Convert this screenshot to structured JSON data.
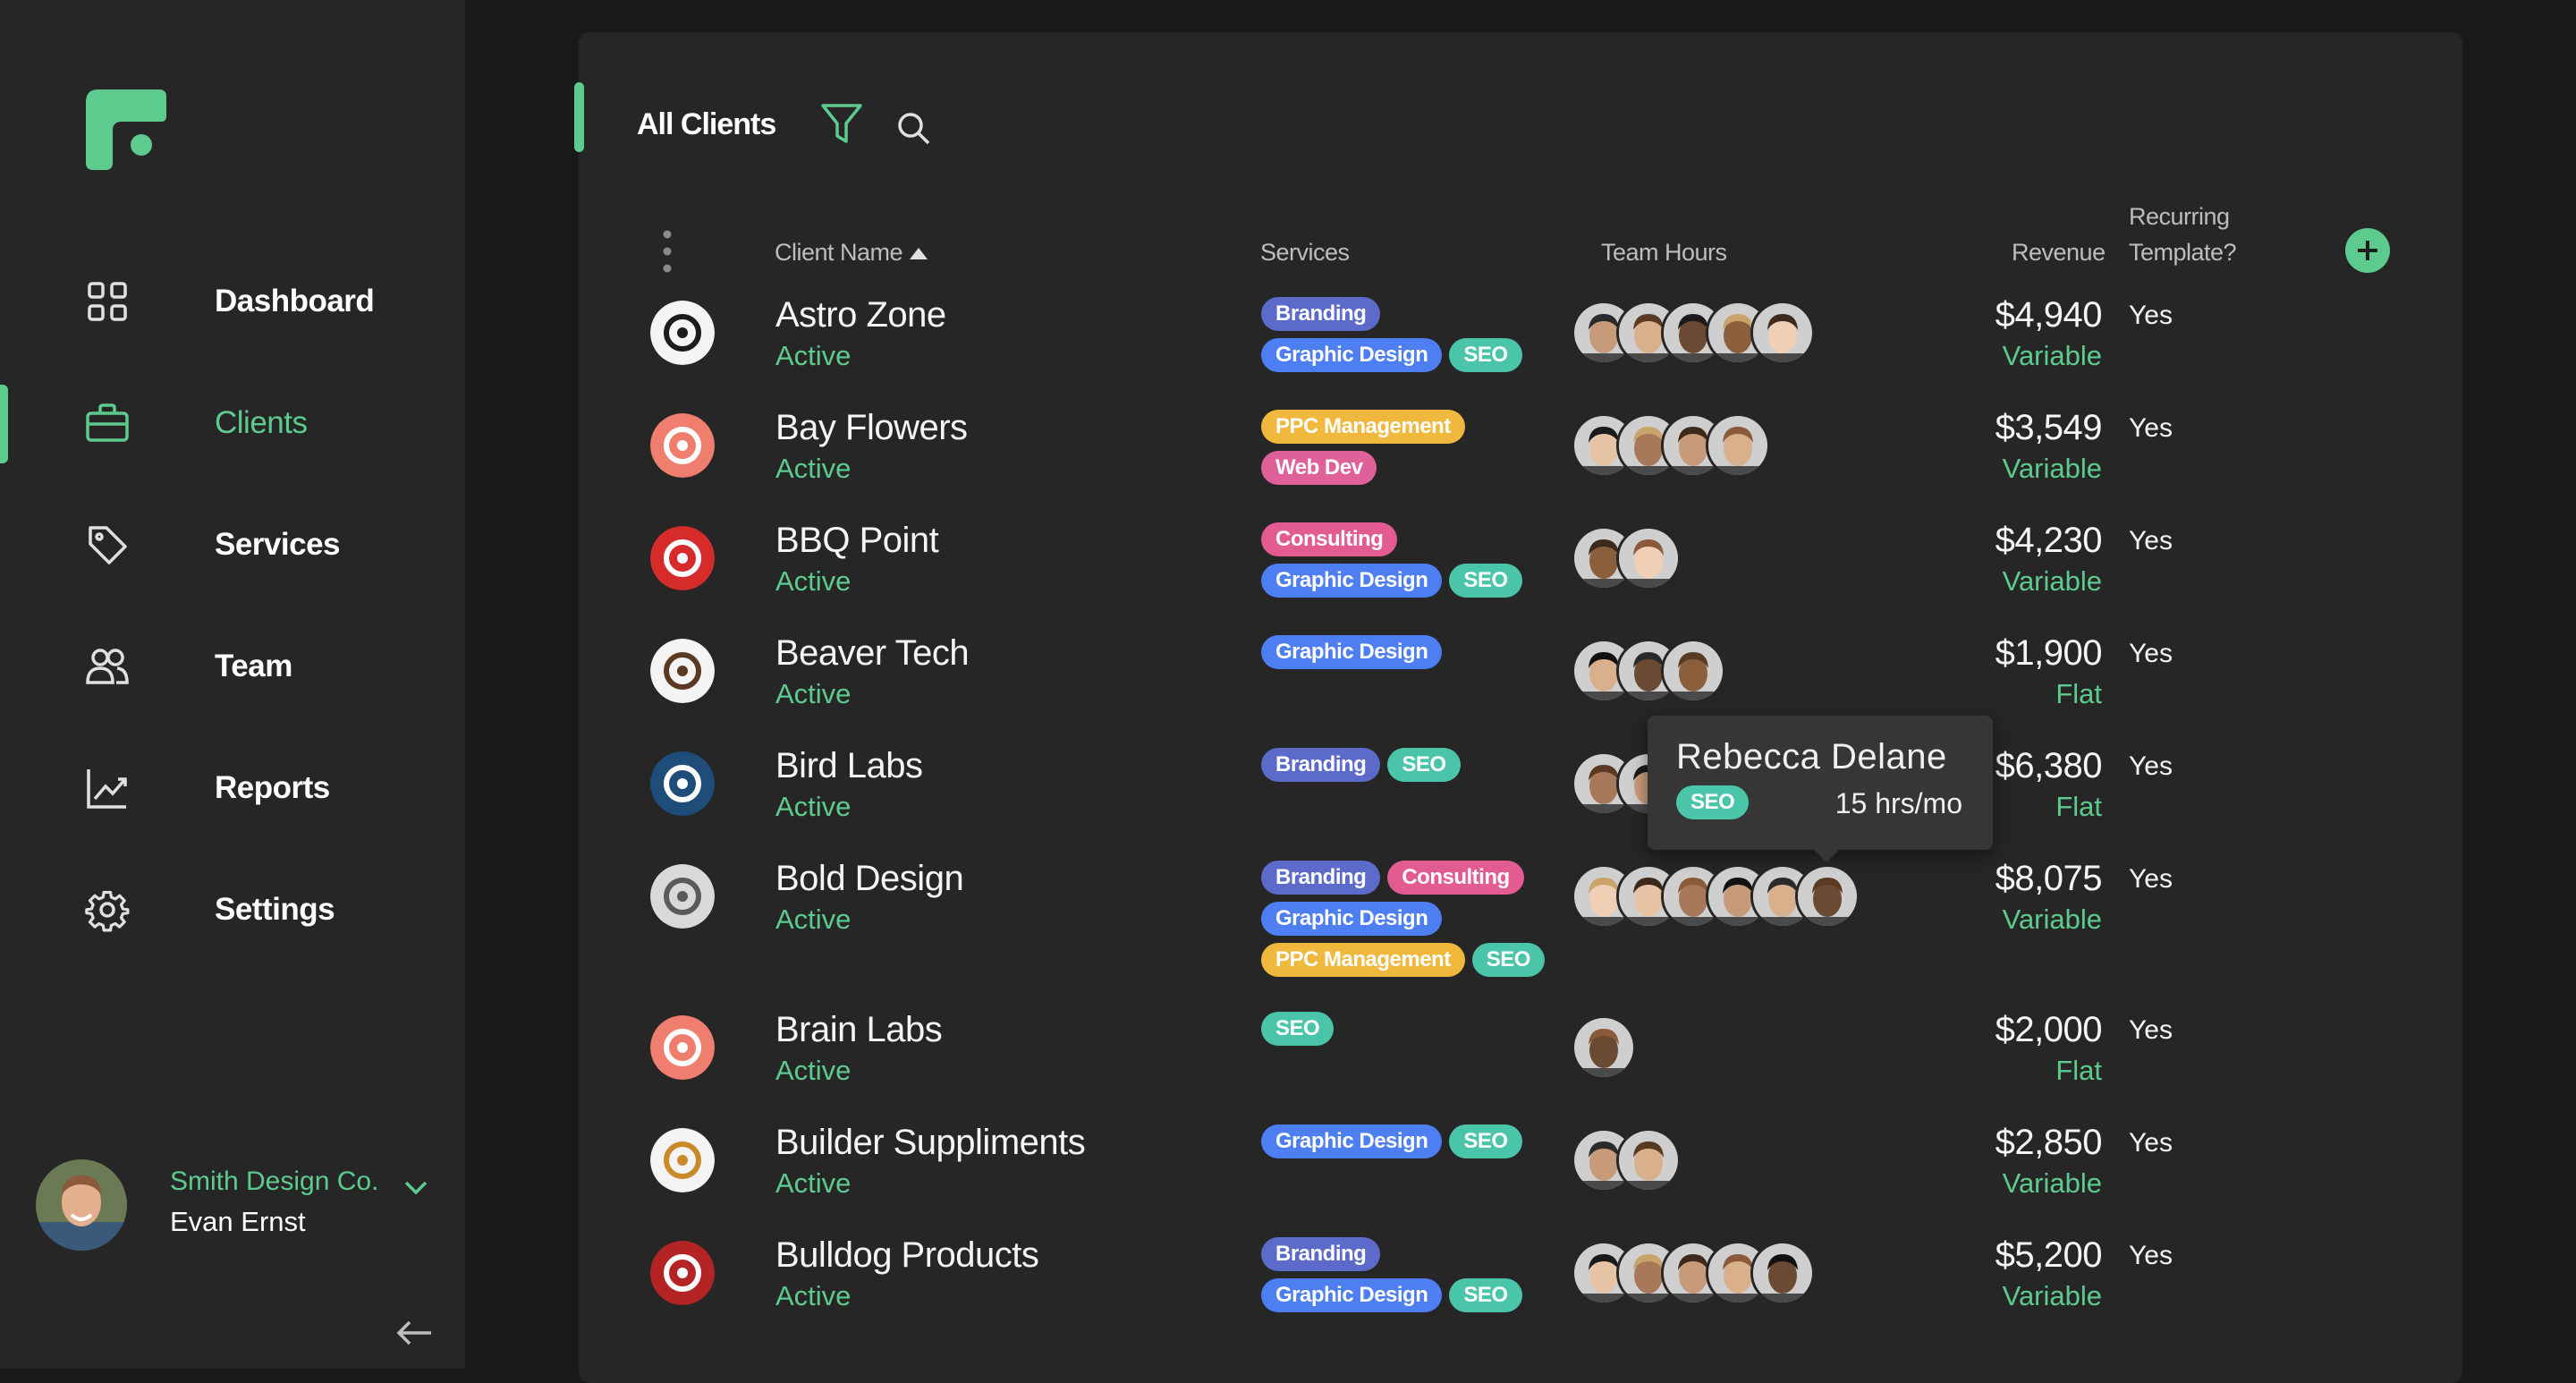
{
  "nav": {
    "items": [
      {
        "label": "Dashboard",
        "icon": "grid-icon"
      },
      {
        "label": "Clients",
        "icon": "briefcase-icon"
      },
      {
        "label": "Services",
        "icon": "tag-icon"
      },
      {
        "label": "Team",
        "icon": "users-icon"
      },
      {
        "label": "Reports",
        "icon": "chart-icon"
      },
      {
        "label": "Settings",
        "icon": "gear-icon"
      }
    ],
    "active": "Clients"
  },
  "org": {
    "company": "Smith Design Co.",
    "user": "Evan Ernst"
  },
  "panel": {
    "title": "All Clients"
  },
  "columns": {
    "client_name": "Client Name",
    "services": "Services",
    "team_hours": "Team Hours",
    "revenue": "Revenue",
    "recurring_line1": "Recurring",
    "recurring_line2": "Template?"
  },
  "clients": [
    {
      "name": "Astro Zone",
      "status": "Active",
      "services": [
        "Branding",
        "Graphic Design",
        "SEO"
      ],
      "team_count": 5,
      "revenue": "$4,940",
      "revenue_type": "Variable",
      "recurring": "Yes"
    },
    {
      "name": "Bay Flowers",
      "status": "Active",
      "services": [
        "PPC Management",
        "Web Dev"
      ],
      "team_count": 4,
      "revenue": "$3,549",
      "revenue_type": "Variable",
      "recurring": "Yes"
    },
    {
      "name": "BBQ Point",
      "status": "Active",
      "services": [
        "Consulting",
        "Graphic Design",
        "SEO"
      ],
      "team_count": 2,
      "revenue": "$4,230",
      "revenue_type": "Variable",
      "recurring": "Yes"
    },
    {
      "name": "Beaver Tech",
      "status": "Active",
      "services": [
        "Graphic Design"
      ],
      "team_count": 3,
      "revenue": "$1,900",
      "revenue_type": "Flat",
      "recurring": "Yes"
    },
    {
      "name": "Bird Labs",
      "status": "Active",
      "services": [
        "Branding",
        "SEO"
      ],
      "team_count": 2,
      "revenue": "$6,380",
      "revenue_type": "Flat",
      "recurring": "Yes"
    },
    {
      "name": "Bold Design",
      "status": "Active",
      "services": [
        "Branding",
        "Consulting",
        "Graphic Design",
        "PPC Management",
        "SEO"
      ],
      "team_count": 6,
      "revenue": "$8,075",
      "revenue_type": "Variable",
      "recurring": "Yes"
    },
    {
      "name": "Brain Labs",
      "status": "Active",
      "services": [
        "SEO"
      ],
      "team_count": 1,
      "revenue": "$2,000",
      "revenue_type": "Flat",
      "recurring": "Yes"
    },
    {
      "name": "Builder Suppliments",
      "status": "Active",
      "services": [
        "Graphic Design",
        "SEO"
      ],
      "team_count": 2,
      "revenue": "$2,850",
      "revenue_type": "Variable",
      "recurring": "Yes"
    },
    {
      "name": "Bulldog Products",
      "status": "Active",
      "services": [
        "Branding",
        "Graphic Design",
        "SEO"
      ],
      "team_count": 5,
      "revenue": "$5,200",
      "revenue_type": "Variable",
      "recurring": "Yes"
    }
  ],
  "tooltip": {
    "name": "Rebecca Delane",
    "service": "SEO",
    "hours": "15 hrs/mo"
  },
  "colors": {
    "accent": "#5ecb8e",
    "sidebar": "#262626",
    "background": "#191919"
  }
}
